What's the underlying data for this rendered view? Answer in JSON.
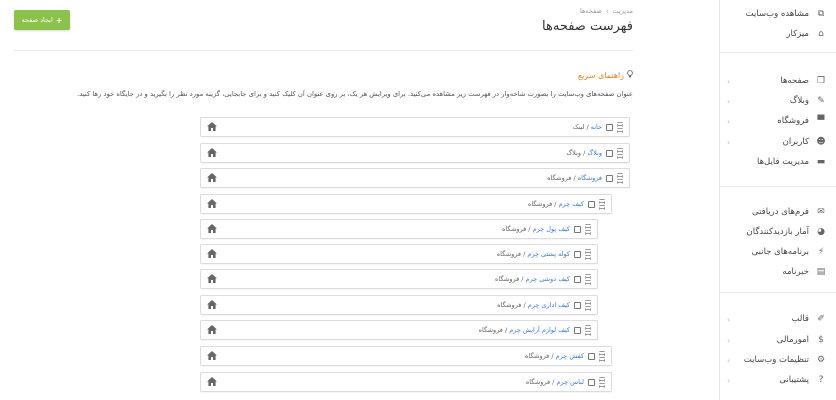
{
  "sidebar": {
    "top_items": [
      {
        "label": "مشاهده وب‌سایت",
        "icon": "external-link-icon"
      },
      {
        "label": "میزکار",
        "icon": "home-icon"
      }
    ],
    "group1": [
      {
        "label": "صفحه‌ها",
        "icon": "pages-icon",
        "chevron": true
      },
      {
        "label": "وبلاگ",
        "icon": "pencil-icon",
        "chevron": true
      },
      {
        "label": "فروشگاه",
        "icon": "cart-icon",
        "chevron": true
      },
      {
        "label": "کاربران",
        "icon": "users-icon",
        "chevron": true
      },
      {
        "label": "مدیریت فایل‌ها",
        "icon": "folder-icon",
        "chevron": false
      }
    ],
    "group2": [
      {
        "label": "فرم‌های دریافتی",
        "icon": "envelope-icon"
      },
      {
        "label": "آمار بازدیدکنندگان",
        "icon": "pie-chart-icon"
      },
      {
        "label": "برنامه‌های جانبی",
        "icon": "plug-icon"
      },
      {
        "label": "خبرنامه",
        "icon": "newspaper-icon"
      }
    ],
    "group3": [
      {
        "label": "قالب",
        "icon": "brush-icon",
        "chevron": true
      },
      {
        "label": "امورمالی",
        "icon": "dollar-icon",
        "chevron": true
      },
      {
        "label": "تنظیمات وب‌سایت",
        "icon": "gear-icon",
        "chevron": true
      },
      {
        "label": "پشتیبانی",
        "icon": "help-icon",
        "chevron": true
      }
    ]
  },
  "header": {
    "create_button": "ایجاد صفحه",
    "breadcrumb": [
      "مدیریت",
      "›",
      "صفحه‌ها"
    ],
    "title": "فهرست صفحه‌ها"
  },
  "guide": {
    "title": "راهنمای سریع",
    "text": "عنوان صفحه‌های وب‌سایت را بصورت شاخه‌وار در فهرست زیر مشاهده می‌کنید. برای ویرایش هر یک، بر روی عنوان آن کلیک کنید و برای جابجایی، گزینه مورد نظر را بگیرید و در جایگاه خود رها کنید."
  },
  "tree": [
    {
      "level": 0,
      "link": "خانه",
      "sep": " / ",
      "path": "لینک"
    },
    {
      "level": 0,
      "link": "وبلاگ",
      "sep": " / ",
      "path": "وبلاگ"
    },
    {
      "level": 0,
      "link": "فروشگاه",
      "sep": " / ",
      "path": "فروشگاه"
    },
    {
      "level": 1,
      "link": "کیف چرم",
      "sep": " / ",
      "path": "فروشگاه"
    },
    {
      "level": 2,
      "link": "کیف پول چرم",
      "sep": " / ",
      "path": "فروشگاه"
    },
    {
      "level": 2,
      "link": "کوله پشتی چرم",
      "sep": " / ",
      "path": "فروشگاه"
    },
    {
      "level": 2,
      "link": "کیف دوشی چرم",
      "sep": " / ",
      "path": "فروشگاه"
    },
    {
      "level": 2,
      "link": "کیف اداری چرم",
      "sep": " / ",
      "path": "فروشگاه"
    },
    {
      "level": 2,
      "link": "کیف لوازم آرایش چرم",
      "sep": " / ",
      "path": "فروشگاه"
    },
    {
      "level": 1,
      "link": "کفش چرم",
      "sep": " / ",
      "path": "فروشگاه"
    },
    {
      "level": 1,
      "link": "لباس چرم",
      "sep": " / ",
      "path": "فروشگاه"
    }
  ]
}
